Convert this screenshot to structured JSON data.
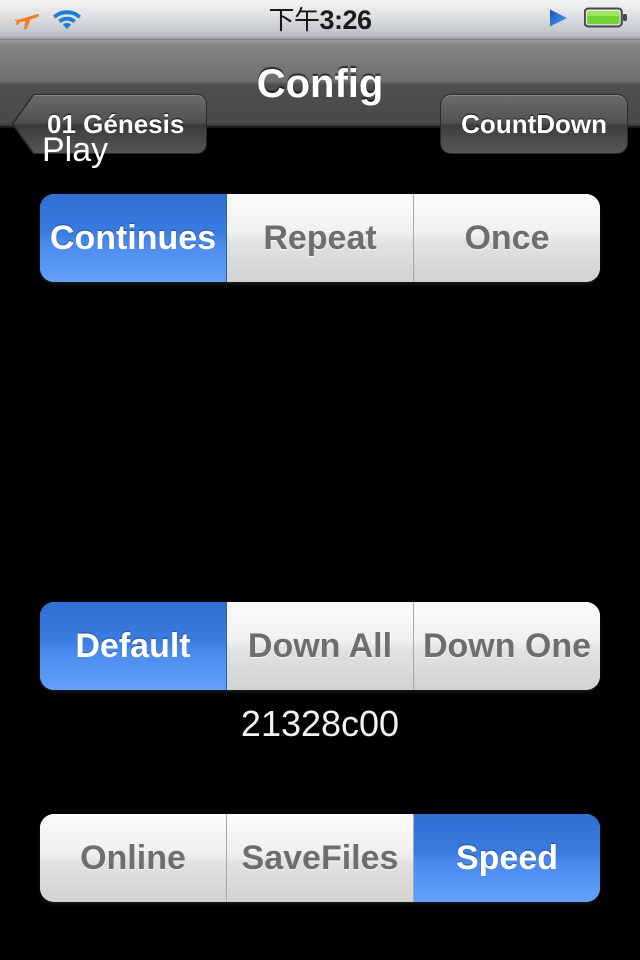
{
  "status_bar": {
    "airplane_icon": "airplane-icon",
    "wifi_icon": "wifi-icon",
    "time_ampm": "下午",
    "time_value": "3:26",
    "play_icon": "play-triangle-icon",
    "battery_icon": "battery-icon"
  },
  "nav_bar": {
    "back_label": "01 Génesis",
    "title": "Config",
    "right_label": "CountDown"
  },
  "content": {
    "section_label": "Play",
    "hex_value": "21328c00",
    "play_mode": {
      "options": [
        "Continues",
        "Repeat",
        "Once"
      ],
      "selected_index": 0
    },
    "download_mode": {
      "options": [
        "Default",
        "Down All",
        "Down One"
      ],
      "selected_index": 0
    },
    "feature_mode": {
      "options": [
        "Online",
        "SaveFiles",
        "Speed"
      ],
      "selected_index": 2
    }
  },
  "colors": {
    "selected_blue": "#3b7ce1",
    "background": "#000000",
    "segment_gray": "#e2e2e2",
    "segment_text": "#6e6e6e",
    "nav_bar_top": "#9b9b9b",
    "status_text": "#1a1a1a",
    "airplane_orange": "#f08020",
    "wifi_blue": "#1d7fd4",
    "battery_green": "#6fcf2f"
  }
}
